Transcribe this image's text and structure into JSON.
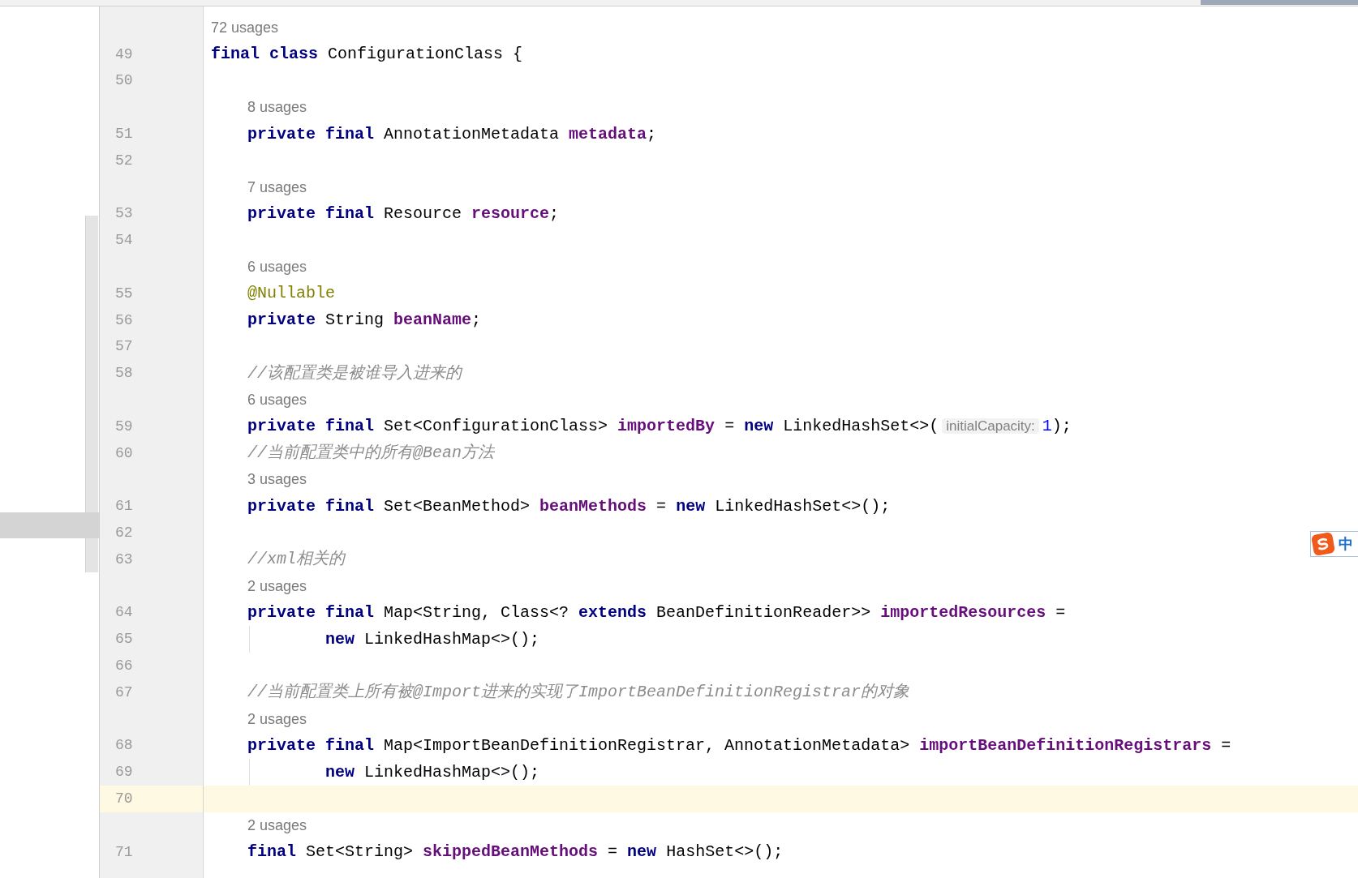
{
  "lines": [
    {
      "kind": "usages",
      "text": "72 usages"
    },
    {
      "kind": "code",
      "number": "49",
      "current": false,
      "tokens": [
        {
          "kind": "keyword",
          "text": "final class"
        },
        {
          "kind": "plain",
          "text": " ConfigurationClass {"
        }
      ],
      "children": [
        {
          "kind": "blank",
          "number": "50",
          "current": false
        },
        {
          "kind": "usages",
          "text": "8 usages"
        },
        {
          "kind": "code",
          "number": "51",
          "current": false,
          "tokens": [
            {
              "kind": "keyword",
              "text": "private final"
            },
            {
              "kind": "plain",
              "text": " AnnotationMetadata "
            },
            {
              "kind": "field",
              "text": "metadata"
            },
            {
              "kind": "plain",
              "text": ";"
            }
          ]
        },
        {
          "kind": "blank",
          "number": "52",
          "current": false
        },
        {
          "kind": "usages",
          "text": "7 usages"
        },
        {
          "kind": "code",
          "number": "53",
          "current": false,
          "tokens": [
            {
              "kind": "keyword",
              "text": "private final"
            },
            {
              "kind": "plain",
              "text": " Resource "
            },
            {
              "kind": "field",
              "text": "resource"
            },
            {
              "kind": "plain",
              "text": ";"
            }
          ]
        },
        {
          "kind": "blank",
          "number": "54",
          "current": false
        },
        {
          "kind": "usages",
          "text": "6 usages"
        },
        {
          "kind": "code",
          "number": "55",
          "current": false,
          "tokens": [
            {
              "kind": "annotation",
              "text": "@Nullable"
            }
          ]
        },
        {
          "kind": "code",
          "number": "56",
          "current": false,
          "tokens": [
            {
              "kind": "keyword",
              "text": "private"
            },
            {
              "kind": "plain",
              "text": " String "
            },
            {
              "kind": "field",
              "text": "beanName"
            },
            {
              "kind": "plain",
              "text": ";"
            }
          ]
        },
        {
          "kind": "blank",
          "number": "57",
          "current": false
        },
        {
          "kind": "code",
          "number": "58",
          "current": false,
          "tokens": [
            {
              "kind": "comment",
              "text": "//该配置类是被谁导入进来的"
            }
          ]
        },
        {
          "kind": "usages",
          "text": "6 usages"
        },
        {
          "kind": "code",
          "number": "59",
          "current": false,
          "tokens": [
            {
              "kind": "keyword",
              "text": "private final"
            },
            {
              "kind": "plain",
              "text": " Set<ConfigurationClass> "
            },
            {
              "kind": "field",
              "text": "importedBy"
            },
            {
              "kind": "plain",
              "text": " = "
            },
            {
              "kind": "keyword",
              "text": "new"
            },
            {
              "kind": "plain",
              "text": " LinkedHashSet<>("
            },
            {
              "kind": "hint",
              "text": "initialCapacity:"
            },
            {
              "kind": "number",
              "text": "1"
            },
            {
              "kind": "plain",
              "text": ");"
            }
          ]
        },
        {
          "kind": "code",
          "number": "60",
          "current": false,
          "tokens": [
            {
              "kind": "comment",
              "text": "//当前配置类中的所有@Bean方法"
            }
          ]
        },
        {
          "kind": "usages",
          "text": "3 usages"
        },
        {
          "kind": "code",
          "number": "61",
          "current": false,
          "tokens": [
            {
              "kind": "keyword",
              "text": "private final"
            },
            {
              "kind": "plain",
              "text": " Set<BeanMethod> "
            },
            {
              "kind": "field",
              "text": "beanMethods"
            },
            {
              "kind": "plain",
              "text": " = "
            },
            {
              "kind": "keyword",
              "text": "new"
            },
            {
              "kind": "plain",
              "text": " LinkedHashSet<>();"
            }
          ]
        },
        {
          "kind": "blank",
          "number": "62",
          "current": false
        },
        {
          "kind": "code",
          "number": "63",
          "current": false,
          "tokens": [
            {
              "kind": "comment",
              "text": "//xml相关的"
            }
          ]
        },
        {
          "kind": "usages",
          "text": "2 usages"
        },
        {
          "kind": "code",
          "number": "64",
          "current": false,
          "tokens": [
            {
              "kind": "keyword",
              "text": "private final"
            },
            {
              "kind": "plain",
              "text": " Map<String, Class<? "
            },
            {
              "kind": "keyword",
              "text": "extends"
            },
            {
              "kind": "plain",
              "text": " BeanDefinitionReader>> "
            },
            {
              "kind": "field",
              "text": "importedResources"
            },
            {
              "kind": "plain",
              "text": " ="
            }
          ]
        },
        {
          "kind": "continuation",
          "number": "65",
          "current": false,
          "tokens": [
            {
              "kind": "keyword",
              "text": "new"
            },
            {
              "kind": "plain",
              "text": " LinkedHashMap<>();"
            }
          ]
        },
        {
          "kind": "blank",
          "number": "66",
          "current": false
        },
        {
          "kind": "code",
          "number": "67",
          "current": false,
          "tokens": [
            {
              "kind": "comment",
              "text": "//当前配置类上所有被@Import进来的实现了ImportBeanDefinitionRegistrar的对象"
            }
          ]
        },
        {
          "kind": "usages",
          "text": "2 usages"
        },
        {
          "kind": "code",
          "number": "68",
          "current": false,
          "tokens": [
            {
              "kind": "keyword",
              "text": "private final"
            },
            {
              "kind": "plain",
              "text": " Map<ImportBeanDefinitionRegistrar, AnnotationMetadata> "
            },
            {
              "kind": "field",
              "text": "importBeanDefinitionRegistrars"
            },
            {
              "kind": "plain",
              "text": " ="
            }
          ]
        },
        {
          "kind": "continuation",
          "number": "69",
          "current": false,
          "tokens": [
            {
              "kind": "keyword",
              "text": "new"
            },
            {
              "kind": "plain",
              "text": " LinkedHashMap<>();"
            }
          ]
        },
        {
          "kind": "blank",
          "number": "70",
          "current": true
        },
        {
          "kind": "usages",
          "text": "2 usages"
        },
        {
          "kind": "code",
          "number": "71",
          "current": false,
          "tokens": [
            {
              "kind": "keyword",
              "text": "final"
            },
            {
              "kind": "plain",
              "text": " Set<String> "
            },
            {
              "kind": "field",
              "text": "skippedBeanMethods"
            },
            {
              "kind": "plain",
              "text": " = "
            },
            {
              "kind": "keyword",
              "text": "new"
            },
            {
              "kind": "plain",
              "text": " HashSet<>();"
            }
          ]
        }
      ]
    }
  ],
  "ime": {
    "mode": "中"
  }
}
